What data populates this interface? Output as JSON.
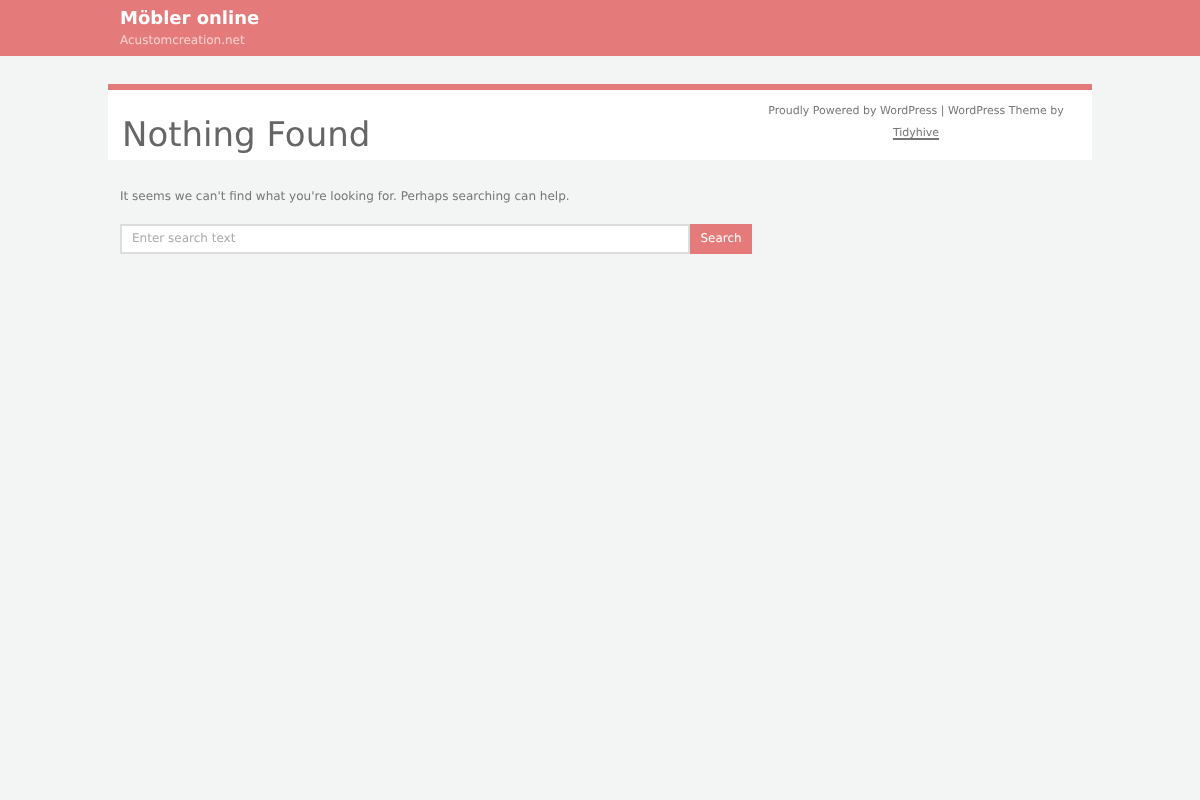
{
  "header": {
    "site_title": "Möbler online",
    "tagline": "Acustomcreation.net"
  },
  "page_header": {
    "title": "Nothing Found",
    "credits": "Proudly Powered by WordPress | WordPress Theme by",
    "credits_link": "Tidyhive"
  },
  "content": {
    "message": "It seems we can't find what you're looking for. Perhaps searching can help.",
    "search": {
      "placeholder": "Enter search text",
      "button": "Search"
    }
  }
}
